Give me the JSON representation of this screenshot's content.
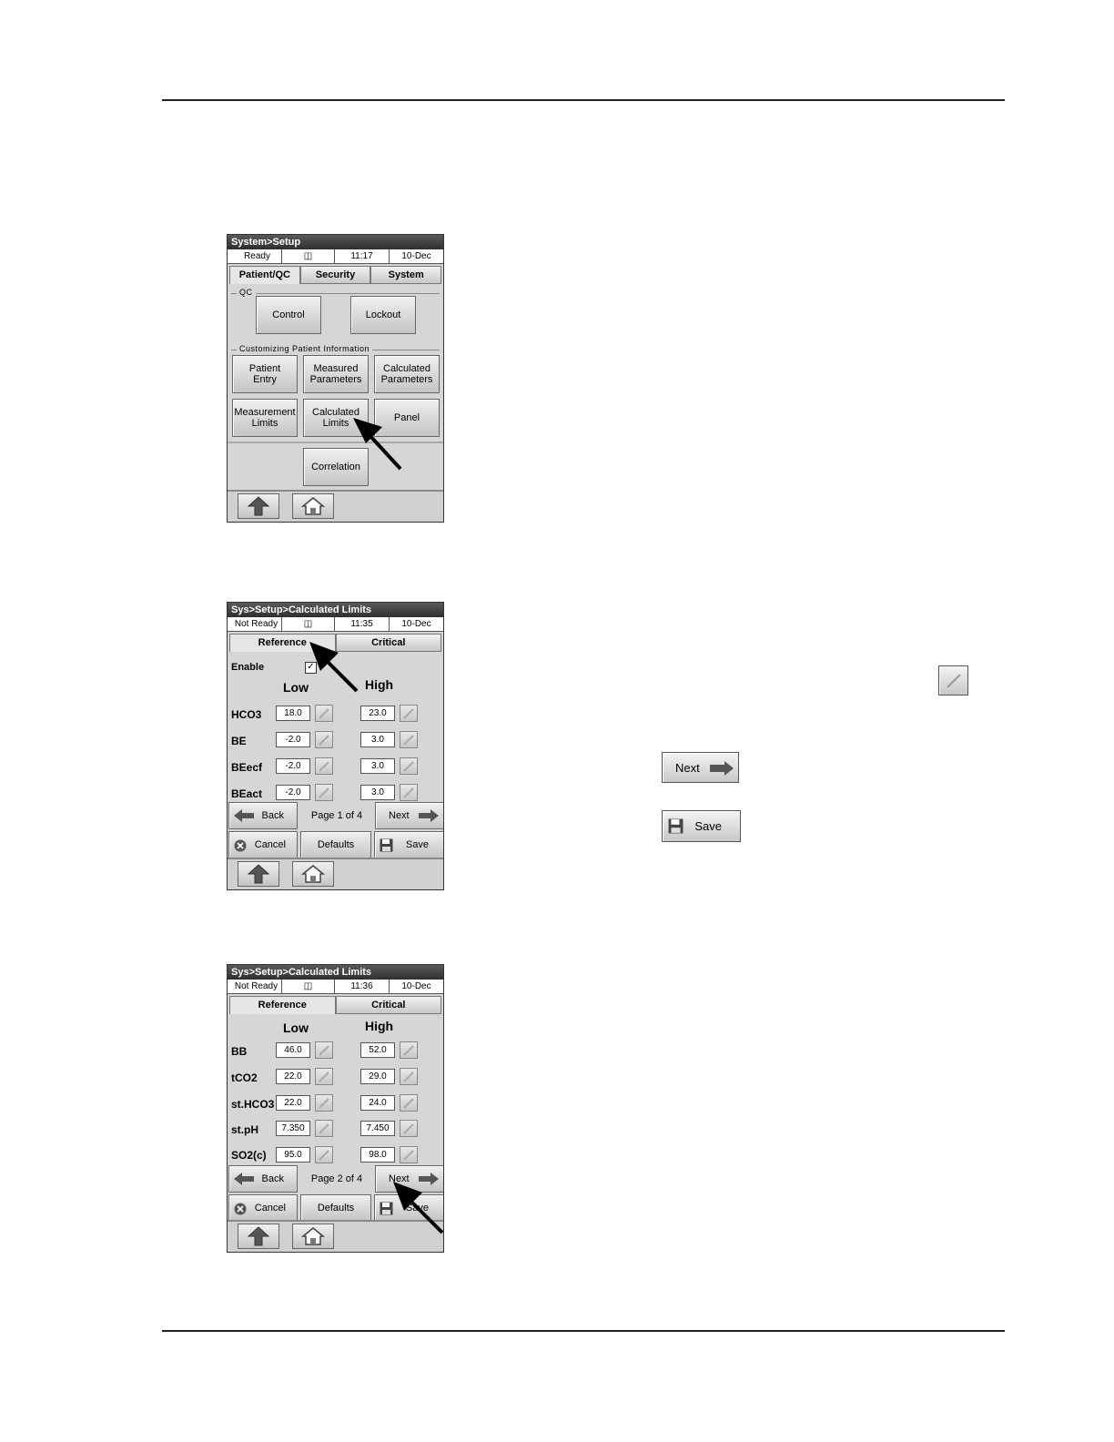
{
  "screen1": {
    "title": "System>Setup",
    "status": {
      "state": "Ready",
      "icon": "printer-icon",
      "time": "11:17",
      "date": "10-Dec"
    },
    "tabs": [
      "Patient/QC",
      "Security",
      "System"
    ],
    "qc_group": "QC",
    "qc_buttons": {
      "control": "Control",
      "lockout": "Lockout"
    },
    "patient_group": "Customizing Patient Information",
    "buttons": {
      "patient_entry": "Patient\nEntry",
      "measured_parameters": "Measured\nParameters",
      "calculated_parameters": "Calculated\nParameters",
      "measurement_limits": "Measurement\nLimits",
      "calculated_limits": "Calculated\nLimits",
      "panel": "Panel",
      "correlation": "Correlation"
    }
  },
  "screen2": {
    "title": "Sys>Setup>Calculated Limits",
    "status": {
      "state": "Not Ready",
      "icon": "printer-icon",
      "time": "11:35",
      "date": "10-Dec"
    },
    "tabs": [
      "Reference",
      "Critical"
    ],
    "enable_label": "Enable",
    "enable_checked": true,
    "low_label": "Low",
    "high_label": "High",
    "rows": [
      {
        "name": "HCO3",
        "low": "18.0",
        "high": "23.0"
      },
      {
        "name": "BE",
        "low": "-2.0",
        "high": "3.0"
      },
      {
        "name": "BEecf",
        "low": "-2.0",
        "high": "3.0"
      },
      {
        "name": "BEact",
        "low": "-2.0",
        "high": "3.0"
      }
    ],
    "back_label": "Back",
    "page_label": "Page 1 of 4",
    "next_label": "Next",
    "cancel_label": "Cancel",
    "defaults_label": "Defaults",
    "save_label": "Save"
  },
  "screen3": {
    "title": "Sys>Setup>Calculated Limits",
    "status": {
      "state": "Not Ready",
      "icon": "printer-icon",
      "time": "11:36",
      "date": "10-Dec"
    },
    "tabs": [
      "Reference",
      "Critical"
    ],
    "low_label": "Low",
    "high_label": "High",
    "rows": [
      {
        "name": "BB",
        "low": "46.0",
        "high": "52.0"
      },
      {
        "name": "tCO2",
        "low": "22.0",
        "high": "29.0"
      },
      {
        "name": "st.HCO3",
        "low": "22.0",
        "high": "24.0"
      },
      {
        "name": "st.pH",
        "low": "7.350",
        "high": "7.450"
      },
      {
        "name": "SO2(c)",
        "low": "95.0",
        "high": "98.0"
      }
    ],
    "back_label": "Back",
    "page_label": "Page 2 of 4",
    "next_label": "Next",
    "cancel_label": "Cancel",
    "defaults_label": "Defaults",
    "save_label": "Save"
  },
  "samples": {
    "next_label": "Next",
    "save_label": "Save"
  }
}
